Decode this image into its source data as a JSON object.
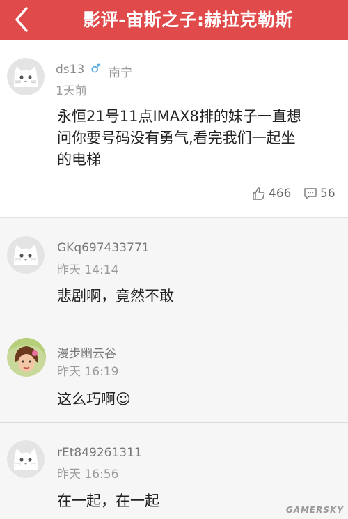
{
  "header": {
    "title": "影评-宙斯之子:赫拉克勒斯",
    "back_icon": "chevron-left-icon",
    "background": "#e14a4a"
  },
  "post": {
    "username": "ds13",
    "gender_symbol": "♂",
    "location": "南宁",
    "time": "1天前",
    "content_lines": [
      "永恒21号11点IMAX8排的妹子一直想",
      "问你要号码没有勇气,看完我们一起坐",
      "的电梯"
    ],
    "likes": "466",
    "comments": "56"
  },
  "replies": [
    {
      "username": "GKq697433771",
      "time": "昨天 14:14",
      "content": "悲剧啊，竟然不敢",
      "avatar": "cat-avatar"
    },
    {
      "username": "漫步幽云谷",
      "time": "昨天 16:19",
      "content": "这么巧啊☺",
      "avatar": "photo-avatar"
    },
    {
      "username": "rEt849261311",
      "time": "昨天 16:56",
      "content": "在一起，在一起",
      "avatar": "cat-avatar"
    }
  ],
  "watermark": "GAMERSKY"
}
